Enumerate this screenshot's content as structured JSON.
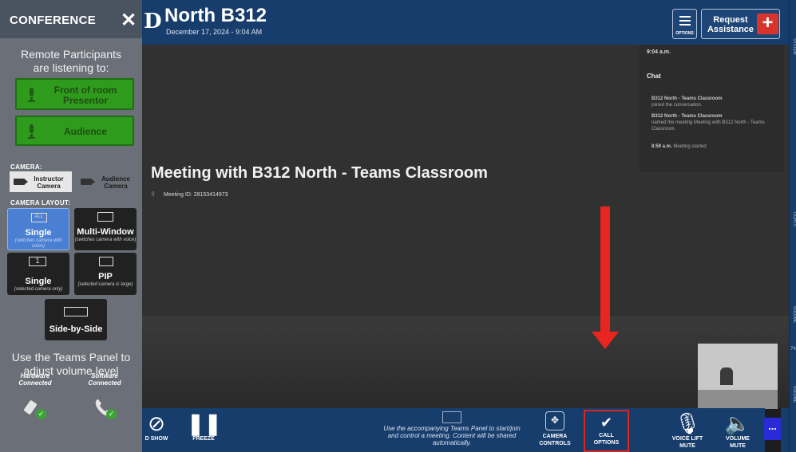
{
  "conference": {
    "title": "CONFERENCE",
    "close_glyph": "✕",
    "remote_text_line1": "Remote Participants",
    "remote_text_line2": "are listening to:",
    "sources": {
      "front_line1": "Front of room",
      "front_line2": "Presentor",
      "audience": "Audience"
    },
    "camera_label": "CAMERA:",
    "cameras": {
      "instructor_line1": "Instructor",
      "instructor_line2": "Camera",
      "audience_line1": "Audience",
      "audience_line2": "Camera"
    },
    "layout_label": "CAMERA LAYOUT:",
    "layouts": {
      "single_icon": "ALL",
      "single_title": "Single",
      "single_sub": "(switches camera with voice)",
      "multi_title": "Multi-Window",
      "multi_sub": "(switches camera with voice)",
      "single_only_icon": "1",
      "single_only_title": "Single",
      "single_only_sub": "(selected camera only)",
      "pip_title": "PIP",
      "pip_sub": "(selected camera is large)",
      "side_title": "Side-by-Side"
    },
    "teams_note": "Use the Teams Panel to adjust volume level",
    "hardware_line1": "Hardware",
    "hardware_line2": "Connected",
    "software_line1": "Software",
    "software_line2": "Connected",
    "check_glyph": "✓"
  },
  "header": {
    "room_name": "North B312",
    "date": "December 17, 2024 - 9:04 AM",
    "options_label": "OPTIONS",
    "request_line1": "Request",
    "request_line2": "Assistance",
    "request_plus": "+"
  },
  "meeting": {
    "title": "Meeting with B312 North - Teams Classroom",
    "meeting_id": "Meeting ID: 28153414973",
    "chat": {
      "time": "9:04 a.m.",
      "header": "Chat",
      "items": [
        {
          "bold": "B312 North - Teams Classroom",
          "text": "joined the conversation."
        },
        {
          "bold": "B312 North - Teams Classroom",
          "text": "named the meeting Meeting with B312 North - Teams Classroom."
        },
        {
          "bold": "8:59 a.m.",
          "text": "Meeting started"
        }
      ]
    }
  },
  "bottom_bar": {
    "show_label": "D SHOW",
    "freeze_label": "FREEZE",
    "note": "Use the accompanying Teams Panel to start/join and control a meeting. Content will be shared automatically.",
    "camera_line1": "CAMERA",
    "camera_line2": "CONTROLS",
    "call_line1": "CALL",
    "call_line2": "OPTIONS",
    "voice_line1": "VOICE LIFT",
    "voice_line2": "MUTE",
    "volume_line1": "VOLUME",
    "volume_line2": "MUTE",
    "more": "..."
  },
  "right_strip": {
    "system": "SYSTEM",
    "lights": "LIGHTS",
    "volume1": "VOLUME",
    "value": "74",
    "volume2": "VOLUME"
  },
  "colors": {
    "header_blue": "#173d6d",
    "green_active": "#2e9b1c",
    "selected_layout": "#4a7fd2",
    "alert_red": "#e8251e"
  },
  "icons": [
    "close-icon",
    "microphone-icon",
    "camera-icon",
    "options-menu-icon",
    "plus-icon",
    "freeze-icon",
    "no-show-icon",
    "camera-controls-icon",
    "call-options-icon",
    "voice-lift-mic-icon",
    "volume-icon",
    "more-icon",
    "check-icon",
    "phone-icon"
  ]
}
